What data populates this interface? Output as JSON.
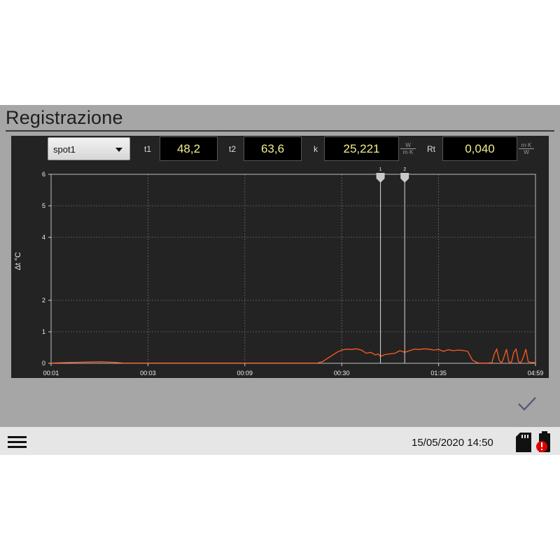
{
  "header": {
    "title": "Registrazione"
  },
  "toolbar": {
    "spot_select": {
      "value": "spot1"
    },
    "t1": {
      "label": "t1",
      "value": "48,2"
    },
    "t2": {
      "label": "t2",
      "value": "63,6"
    },
    "k": {
      "label": "k",
      "value": "25,221",
      "unit_num": "W",
      "unit_den": "m·K"
    },
    "rt": {
      "label": "Rt",
      "value": "0,040",
      "unit_num": "m·K",
      "unit_den": "W"
    }
  },
  "chart_data": {
    "type": "line",
    "ylabel": "Δt °C",
    "ylim": [
      0,
      6
    ],
    "yticks": [
      "0",
      "1",
      "2",
      "4",
      "5",
      "6"
    ],
    "xticks": [
      "00:01",
      "00:03",
      "00:09",
      "00:30",
      "01:35",
      "04:59"
    ],
    "grid": true,
    "series": [
      {
        "color": "#ff5a1f",
        "x": [
          0,
          0.02,
          0.05,
          0.08,
          0.1,
          0.13,
          0.15,
          0.2,
          0.3,
          0.4,
          0.5,
          0.55,
          0.56,
          0.57,
          0.58,
          0.59,
          0.6,
          0.61,
          0.62,
          0.63,
          0.64,
          0.645,
          0.65,
          0.66,
          0.67,
          0.675,
          0.68,
          0.69,
          0.7,
          0.71,
          0.72,
          0.73,
          0.74,
          0.75,
          0.76,
          0.77,
          0.78,
          0.79,
          0.8,
          0.81,
          0.82,
          0.83,
          0.84,
          0.85,
          0.86,
          0.87,
          0.88,
          0.885,
          0.89,
          0.9,
          0.91,
          0.915,
          0.92,
          0.925,
          0.93,
          0.935,
          0.94,
          0.945,
          0.95,
          0.955,
          0.96,
          0.965,
          0.97,
          0.975,
          0.98,
          0.985,
          0.99,
          1.0
        ],
        "y": [
          0.01,
          0.02,
          0.03,
          0.04,
          0.05,
          0.03,
          0.01,
          0.01,
          0.01,
          0.01,
          0.01,
          0.01,
          0.05,
          0.15,
          0.25,
          0.35,
          0.42,
          0.45,
          0.44,
          0.46,
          0.42,
          0.38,
          0.32,
          0.35,
          0.26,
          0.3,
          0.22,
          0.28,
          0.3,
          0.32,
          0.4,
          0.35,
          0.4,
          0.45,
          0.44,
          0.46,
          0.45,
          0.42,
          0.44,
          0.38,
          0.43,
          0.4,
          0.42,
          0.41,
          0.38,
          0.1,
          0.02,
          0.01,
          0.01,
          0.01,
          0.02,
          0.3,
          0.45,
          0.1,
          0.01,
          0.2,
          0.45,
          0.05,
          0.01,
          0.35,
          0.45,
          0.05,
          0.02,
          0.2,
          0.45,
          0.05,
          0.03,
          0.02
        ]
      }
    ],
    "markers": [
      {
        "label": "1",
        "x": 0.68
      },
      {
        "label": "2",
        "x": 0.73
      }
    ]
  },
  "actions": {
    "confirm_icon": "checkmark-icon"
  },
  "status_bar": {
    "menu_icon": "hamburger-menu-icon",
    "datetime": "15/05/2020 14:50",
    "sd_icon": "sd-card-icon",
    "battery_icon": "battery-warning-icon",
    "warning_color": "#e00000"
  }
}
